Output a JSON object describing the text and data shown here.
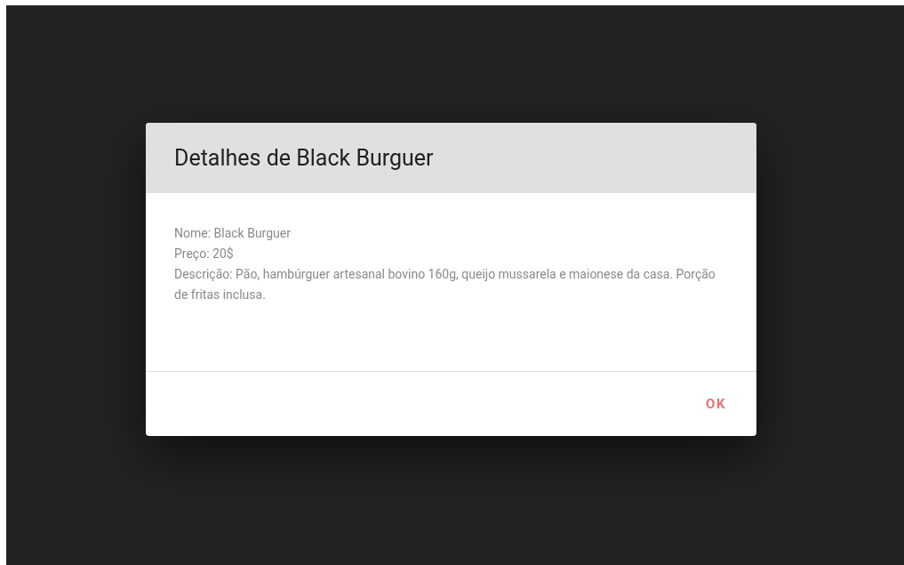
{
  "dialog": {
    "title": "Detalhes de Black Burguer",
    "lines": [
      "Nome: Black Burguer",
      "Preço: 20$",
      "Descrição: Pão, hambúrguer artesanal bovino 160g, queijo mussarela e maionese da casa. Porção de fritas inclusa."
    ],
    "buttons": [
      "OK"
    ]
  }
}
